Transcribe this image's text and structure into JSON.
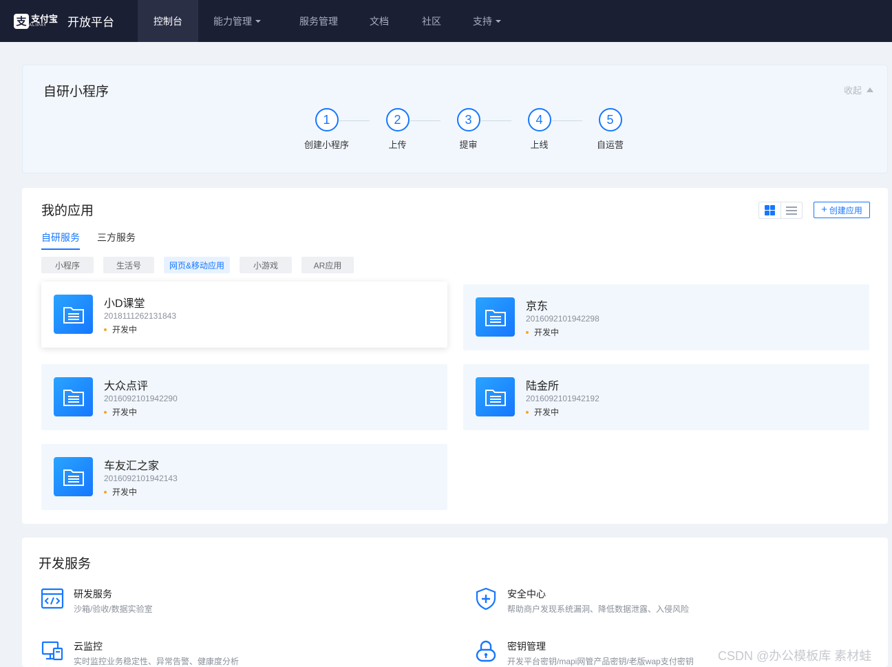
{
  "nav": {
    "logo_cn": "支付宝",
    "logo_en": "ALIPAY",
    "logo_mark": "支",
    "brand": "开放平台",
    "items": [
      {
        "label": "控制台",
        "active": true,
        "dropdown": false
      },
      {
        "label": "能力管理",
        "active": false,
        "dropdown": true
      },
      {
        "label": "服务管理",
        "active": false,
        "dropdown": false
      },
      {
        "label": "文档",
        "active": false,
        "dropdown": false
      },
      {
        "label": "社区",
        "active": false,
        "dropdown": false
      },
      {
        "label": "支持",
        "active": false,
        "dropdown": true
      }
    ]
  },
  "miniprogram": {
    "title": "自研小程序",
    "collapse": "收起",
    "steps": [
      {
        "num": "1",
        "label": "创建小程序"
      },
      {
        "num": "2",
        "label": "上传"
      },
      {
        "num": "3",
        "label": "提审"
      },
      {
        "num": "4",
        "label": "上线"
      },
      {
        "num": "5",
        "label": "自运营"
      }
    ]
  },
  "apps": {
    "title": "我的应用",
    "create": "创建应用",
    "tabs": [
      {
        "label": "自研服务",
        "active": true
      },
      {
        "label": "三方服务",
        "active": false
      }
    ],
    "filters": [
      {
        "label": "小程序",
        "active": false
      },
      {
        "label": "生活号",
        "active": false
      },
      {
        "label": "网页&移动应用",
        "active": true
      },
      {
        "label": "小游戏",
        "active": false
      },
      {
        "label": "AR应用",
        "active": false
      }
    ],
    "list": [
      {
        "name": "小D课堂",
        "id": "2018111262131843",
        "status": "开发中"
      },
      {
        "name": "京东",
        "id": "2016092101942298",
        "status": "开发中"
      },
      {
        "name": "大众点评",
        "id": "2016092101942290",
        "status": "开发中"
      },
      {
        "name": "陆金所",
        "id": "2016092101942192",
        "status": "开发中"
      },
      {
        "name": "车友汇之家",
        "id": "2016092101942143",
        "status": "开发中"
      }
    ]
  },
  "dev": {
    "title": "开发服务",
    "services": [
      {
        "title": "研发服务",
        "desc": "沙箱/验收/数据实验室",
        "icon": "code-window-icon"
      },
      {
        "title": "安全中心",
        "desc": "帮助商户发现系统漏洞、降低数据泄露、入侵风险",
        "icon": "shield-plus-icon"
      },
      {
        "title": "云监控",
        "desc": "实时监控业务稳定性、异常告警、健康度分析",
        "icon": "monitor-icon"
      },
      {
        "title": "密钥管理",
        "desc": "开发平台密钥/mapi网管产品密钥/老版wap支付密钥",
        "icon": "lock-icon"
      }
    ]
  },
  "watermark": "CSDN @办公模板库 素材蛙",
  "colors": {
    "accent": "#1677ff",
    "nav_bg": "#1b1f33",
    "status_dot": "#f5a623"
  }
}
